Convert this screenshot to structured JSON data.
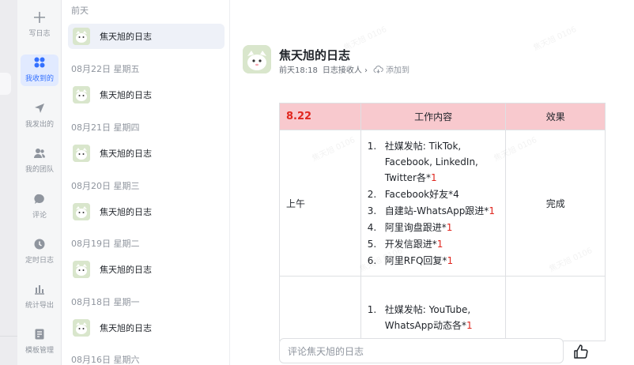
{
  "nav": {
    "items": [
      {
        "label": "写日志",
        "icon": "plus-icon"
      },
      {
        "label": "我收到的",
        "icon": "grid-icon"
      },
      {
        "label": "我发出的",
        "icon": "send-icon"
      },
      {
        "label": "我的团队",
        "icon": "team-icon"
      },
      {
        "label": "评论",
        "icon": "comment-icon"
      },
      {
        "label": "定时日志",
        "icon": "clock-icon"
      },
      {
        "label": "统计导出",
        "icon": "chart-icon"
      },
      {
        "label": "模板管理",
        "icon": "template-icon"
      }
    ]
  },
  "list": {
    "groups": [
      {
        "date": "前天",
        "entry": "焦天旭的日志"
      },
      {
        "date": "08月22日 星期五",
        "entry": "焦天旭的日志"
      },
      {
        "date": "08月21日 星期四",
        "entry": "焦天旭的日志"
      },
      {
        "date": "08月20日 星期三",
        "entry": "焦天旭的日志"
      },
      {
        "date": "08月19日 星期二",
        "entry": "焦天旭的日志"
      },
      {
        "date": "08月18日 星期一",
        "entry": "焦天旭的日志"
      },
      {
        "date": "08月16日 星期六",
        "entry": ""
      }
    ]
  },
  "doc": {
    "title": "焦天旭的日志",
    "time": "前天18:18",
    "receivers": "日志接收人",
    "add_to": "添加到",
    "table": {
      "date": "8.22",
      "col_work": "工作内容",
      "col_result": "效果",
      "rows": [
        {
          "time": "上午",
          "result": "完成",
          "tasks": [
            {
              "num": "1.",
              "text": "社媒发帖: TikTok, Facebook, LinkedIn, Twitter各*",
              "red": "1"
            },
            {
              "num": "2.",
              "text": "Facebook好友*4",
              "red": ""
            },
            {
              "num": "3.",
              "text": "自建站-WhatsApp跟进*",
              "red": "1"
            },
            {
              "num": "4.",
              "text": "阿里询盘跟进*",
              "red": "1"
            },
            {
              "num": "5.",
              "text": "开发信跟进*",
              "red": "1"
            },
            {
              "num": "6.",
              "text": "阿里RFQ回复*",
              "red": "1"
            }
          ]
        },
        {
          "time": "",
          "result": "",
          "tasks": [
            {
              "num": "1.",
              "text": "社媒发帖: YouTube, WhatsApp动态各*",
              "red": "1"
            }
          ]
        }
      ]
    },
    "comment_placeholder": "评论焦天旭的日志"
  },
  "watermark": "焦天旭 0106"
}
